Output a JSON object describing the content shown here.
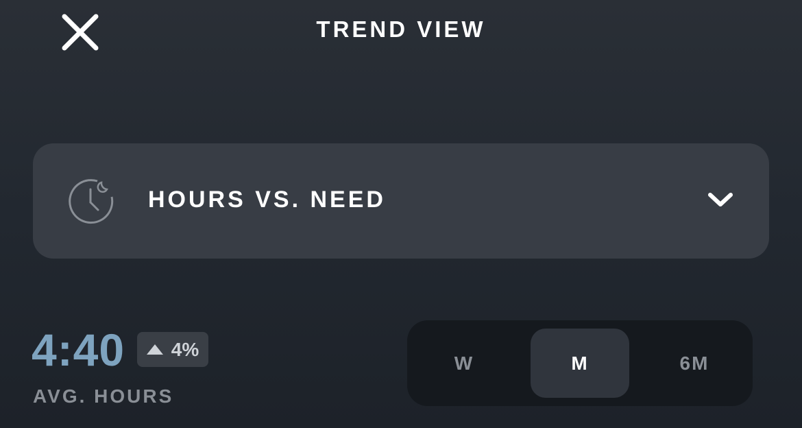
{
  "header": {
    "title": "TREND VIEW",
    "close_icon": "close-icon"
  },
  "metric_selector": {
    "icon": "sleep-clock-icon",
    "label": "HOURS VS. NEED",
    "chevron_icon": "chevron-down-icon"
  },
  "summary": {
    "value": "4:40",
    "change": {
      "direction": "up",
      "icon": "triangle-up-icon",
      "text": "4%"
    },
    "label": "AVG. HOURS"
  },
  "range_toggle": {
    "options": [
      {
        "label": "W",
        "selected": false
      },
      {
        "label": "M",
        "selected": true
      },
      {
        "label": "6M",
        "selected": false
      }
    ]
  },
  "colors": {
    "accent_value": "#7ea3bf",
    "panel": "#383d45",
    "toggle_bg": "#15191e",
    "toggle_active": "#30353d"
  }
}
